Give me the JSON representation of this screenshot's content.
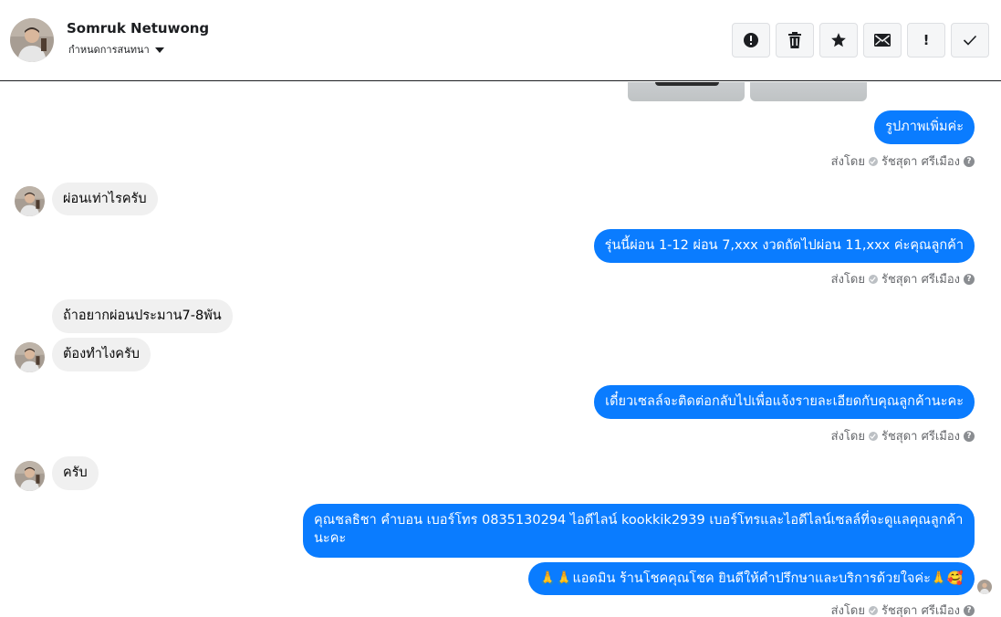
{
  "header": {
    "contact_name": "Somruk Netuwong",
    "conversation_settings": "กำหนดการสนทนา"
  },
  "toolbar": {
    "buttons": [
      {
        "icon": "alert-circle-icon",
        "label": "Report"
      },
      {
        "icon": "trash-icon",
        "label": "Delete"
      },
      {
        "icon": "star-icon",
        "label": "Star"
      },
      {
        "icon": "envelope-icon",
        "label": "Mark as unread"
      },
      {
        "icon": "exclamation-icon",
        "label": "!"
      },
      {
        "icon": "checkmark-icon",
        "label": "Done"
      }
    ]
  },
  "messages": [
    {
      "id": "m1",
      "direction": "out",
      "text": "รูปภาพเพิ่มค่ะ"
    },
    {
      "id": "m2",
      "direction": "in",
      "text": "ผ่อนเท่าไรครับ"
    },
    {
      "id": "m3",
      "direction": "out",
      "text": "รุ่นนี้ผ่อน 1-12 ผ่อน 7,xxx งวดถัดไปผ่อน 11,xxx ค่ะคุณลูกค้า"
    },
    {
      "id": "m4",
      "direction": "in",
      "text": "ถ้าอยากผ่อนประมาน7-8พัน"
    },
    {
      "id": "m5",
      "direction": "in",
      "text": "ต้องทำไงครับ"
    },
    {
      "id": "m6",
      "direction": "out",
      "text": "เดี๋ยวเซลล์จะติดต่อกลับไปเพื่อแจ้งรายละเอียดกับคุณลูกค้านะคะ"
    },
    {
      "id": "m7",
      "direction": "in",
      "text": "ครับ"
    },
    {
      "id": "m8",
      "direction": "out",
      "text": "คุณชลธิชา คำบอน เบอร์โทร 0835130294  ไอดีไลน์ kookkik2939   เบอร์โทรและไอดีไลน์เซลล์ที่จะดูแลคุณลูกค้านะคะ"
    },
    {
      "id": "m9",
      "direction": "out",
      "text": "🙏🙏แอดมิน ร้านโชคคุณโชค ยินดีให้คำปรึกษาและบริการด้วยใจค่ะ🙏🥰"
    }
  ],
  "sent_by": {
    "prefix": "ส่งโดย",
    "agent": "รัชสุดา ศรีเมือง",
    "help": "?"
  },
  "colors": {
    "outgoing_bubble": "#0a7cff",
    "incoming_bubble": "#f0f0f0",
    "meta_text": "#65676b"
  }
}
